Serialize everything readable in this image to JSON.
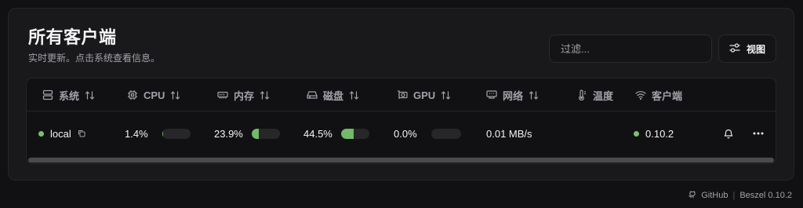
{
  "header": {
    "title": "所有客户端",
    "subtitle": "实时更新。点击系统查看信息。"
  },
  "toolbar": {
    "filter_placeholder": "过滤...",
    "view_label": "视图"
  },
  "table": {
    "columns": [
      {
        "label": "系统",
        "icon": "server-icon",
        "sortable": true
      },
      {
        "label": "CPU",
        "icon": "cpu-icon",
        "sortable": true
      },
      {
        "label": "内存",
        "icon": "memory-icon",
        "sortable": true
      },
      {
        "label": "磁盘",
        "icon": "hard-drive-icon",
        "sortable": true
      },
      {
        "label": "GPU",
        "icon": "gpu-icon",
        "sortable": true
      },
      {
        "label": "网络",
        "icon": "network-icon",
        "sortable": true
      },
      {
        "label": "温度",
        "icon": "thermometer-icon",
        "sortable": false
      },
      {
        "label": "客户端",
        "icon": "wifi-icon",
        "sortable": false
      }
    ],
    "rows": [
      {
        "name": "local",
        "status_color": "#7cc06f",
        "cpu": "1.4%",
        "cpu_fraction": 0.014,
        "memory": "23.9%",
        "memory_fraction": 0.239,
        "disk": "44.5%",
        "disk_fraction": 0.445,
        "gpu": "0.0%",
        "gpu_fraction": 0.0,
        "network": "0.01 MB/s",
        "temperature": "",
        "agent_version": "0.10.2"
      }
    ]
  },
  "footer": {
    "github_label": "GitHub",
    "separator": "|",
    "version_label": "Beszel 0.10.2"
  },
  "colors": {
    "accent": "#72b968",
    "status_up": "#7cc06f",
    "background": "#111113",
    "card": "#19191b"
  }
}
